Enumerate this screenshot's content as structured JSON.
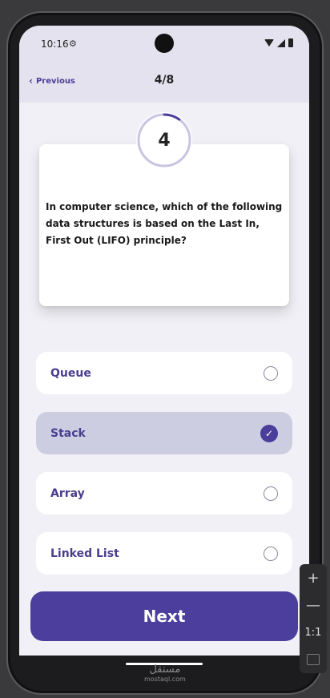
{
  "status_bar": {
    "time": "10:16",
    "gear": "⚙"
  },
  "header": {
    "previous_label": "Previous",
    "progress": "4/8"
  },
  "question": {
    "number": "4",
    "text": "In computer science, which of the following data structures is based on the Last In, First Out (LIFO) principle?",
    "timer_fraction": 0.1
  },
  "options": [
    {
      "label": "Queue",
      "selected": false
    },
    {
      "label": "Stack",
      "selected": true
    },
    {
      "label": "Array",
      "selected": false
    },
    {
      "label": "Linked List",
      "selected": false
    }
  ],
  "next_label": "Next",
  "zoom": {
    "plus": "+",
    "minus": "—",
    "ratio": "1:1"
  },
  "watermark": {
    "arabic": "مستقل",
    "domain": "mostaql.com"
  },
  "colors": {
    "accent": "#4b3e9c",
    "selected_bg": "#cdcde2",
    "header_bg": "#e4e2ee",
    "bg": "#f0f0f6"
  },
  "icons": {
    "back": "chevron-left-icon",
    "check": "check-circle-icon",
    "radio": "radio-empty-icon"
  }
}
